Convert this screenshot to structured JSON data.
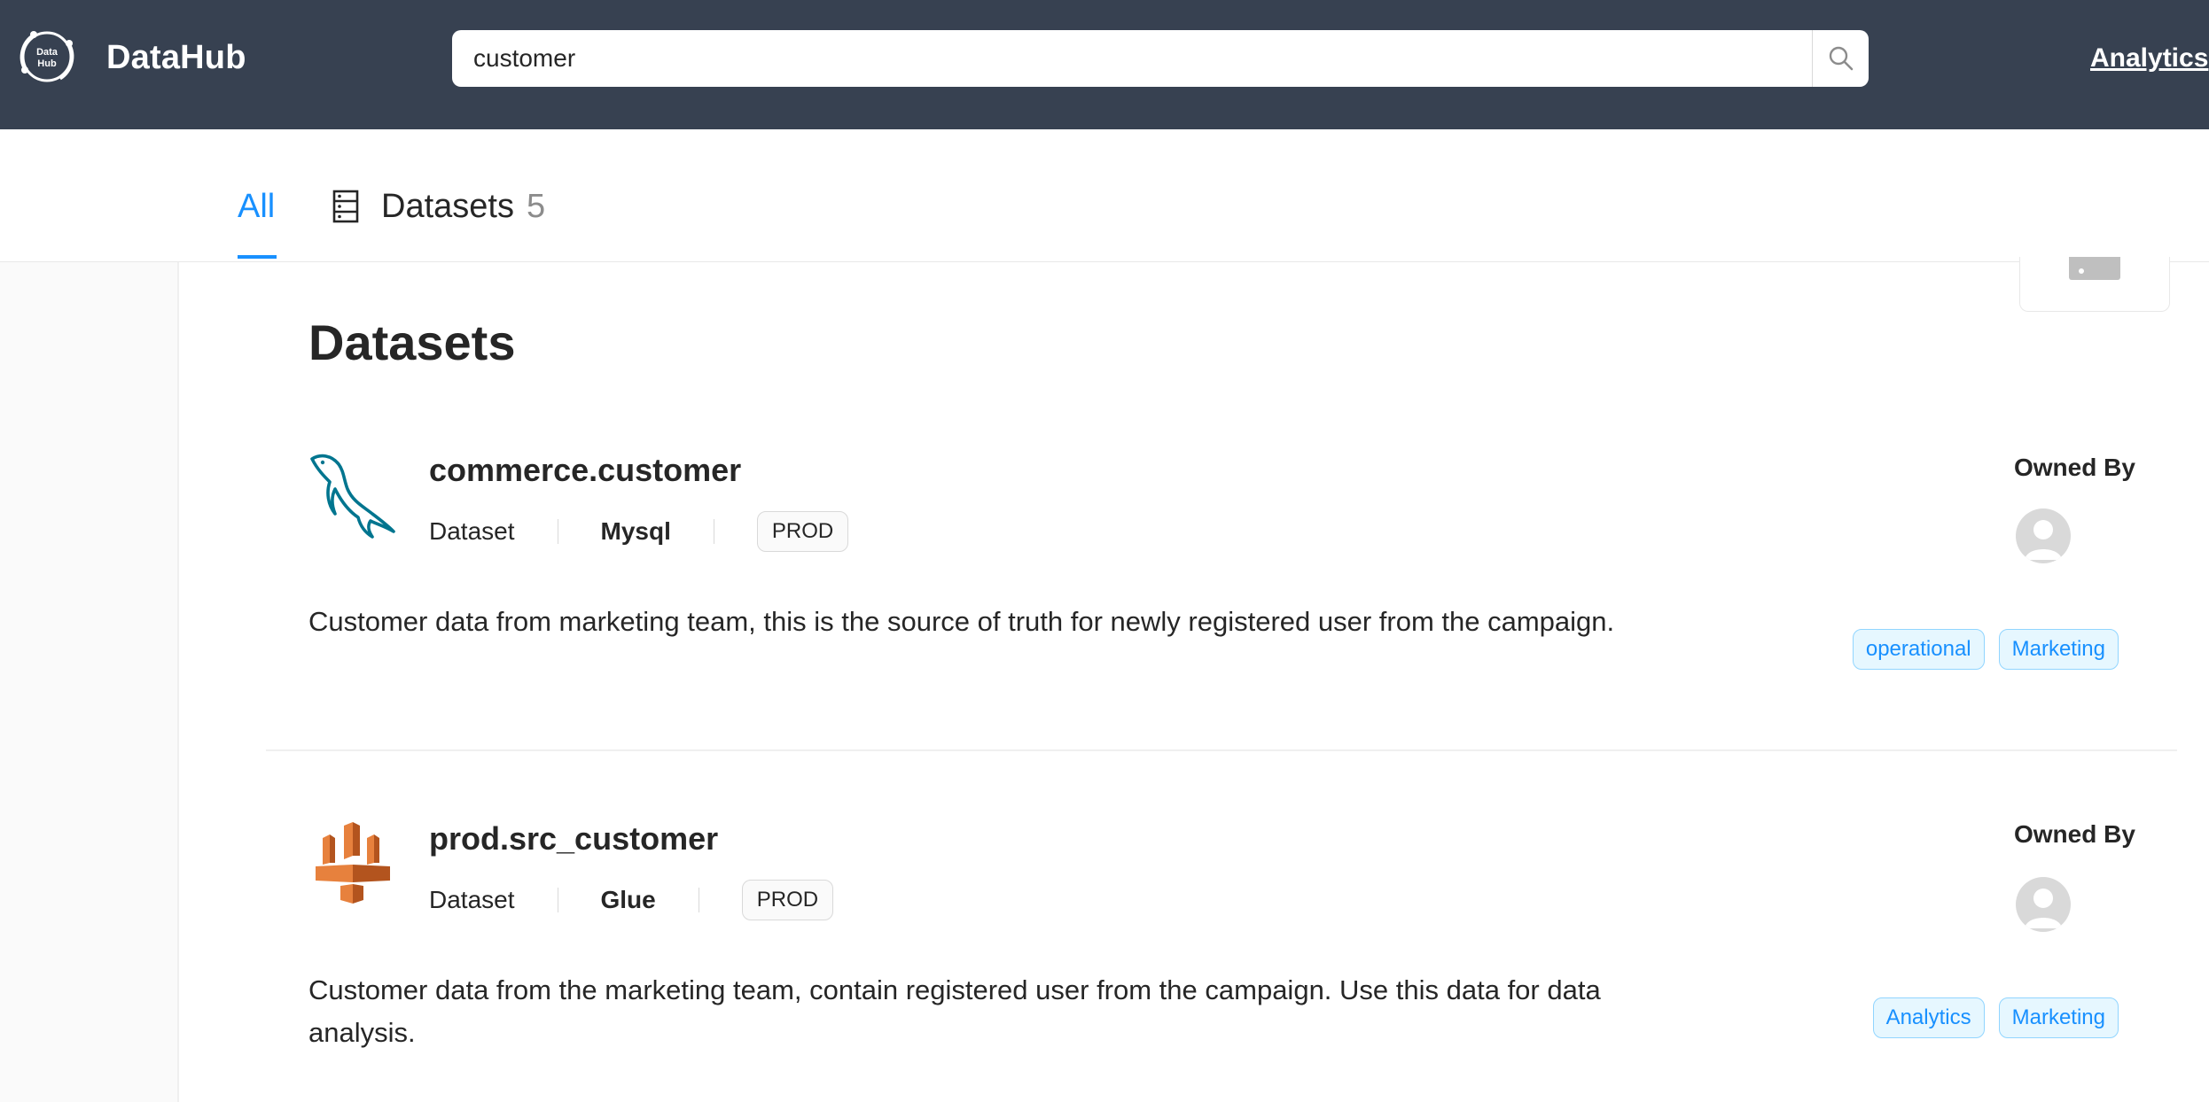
{
  "header": {
    "brand": "DataHub",
    "logo_text_line1": "Data",
    "logo_text_line2": "Hub",
    "search_value": "customer",
    "right_link": "Analytics"
  },
  "tabs": {
    "all_label": "All",
    "datasets_label": "Datasets",
    "datasets_count": "5"
  },
  "section_title": "Datasets",
  "results": [
    {
      "name": "commerce.customer",
      "type": "Dataset",
      "platform": "Mysql",
      "env": "PROD",
      "description": "Customer data from marketing team, this is the source of truth for newly registered user from the campaign.",
      "owned_by_label": "Owned By",
      "tags": [
        "operational",
        "Marketing"
      ]
    },
    {
      "name": "prod.src_customer",
      "type": "Dataset",
      "platform": "Glue",
      "env": "PROD",
      "description": "Customer data from the marketing team, contain registered user from the campaign. Use this data for data analysis.",
      "owned_by_label": "Owned By",
      "tags": [
        "Analytics",
        "Marketing"
      ]
    }
  ],
  "colors": {
    "header_bg": "#374151",
    "accent": "#1890ff",
    "tag_bg": "#e6f7ff",
    "mysql_teal": "#00758f",
    "glue_orange": "#e7813d"
  }
}
